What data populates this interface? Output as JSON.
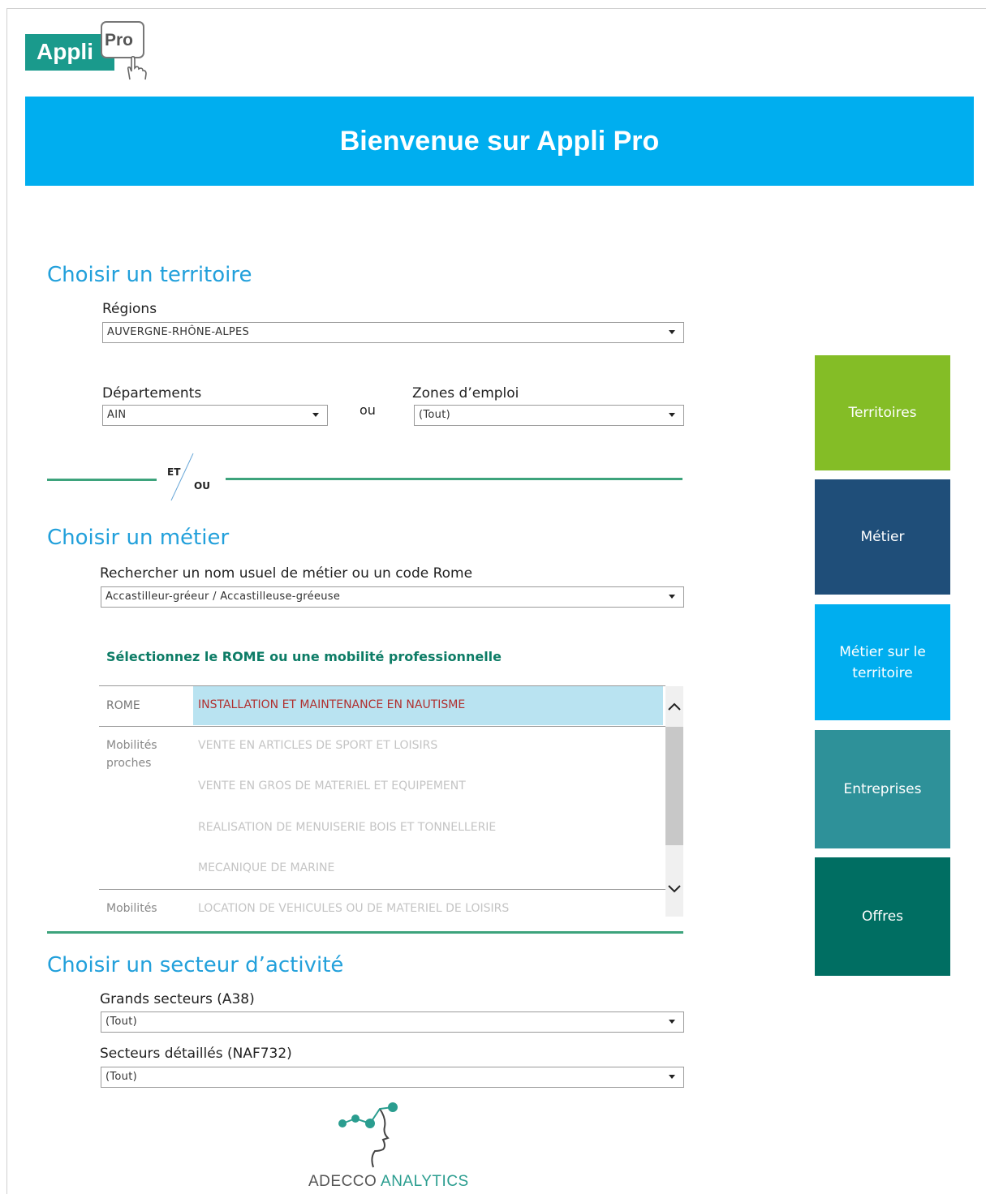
{
  "logo": {
    "word": "Appli",
    "badge": "Pro"
  },
  "banner": {
    "title": "Bienvenue sur Appli Pro",
    "color": "#00aeef"
  },
  "territoire": {
    "title": "Choisir un territoire",
    "regions_label": "Régions",
    "regions_value": "AUVERGNE-RHÔNE-ALPES",
    "departements_label": "Départements",
    "departements_value": "AIN",
    "ou": "ou",
    "zones_label": "Zones d’emploi",
    "zones_value": "(Tout)"
  },
  "separator": {
    "et": "ET",
    "ou": "OU"
  },
  "metier": {
    "title": "Choisir un métier",
    "search_label": "Rechercher un nom usuel de métier ou un code Rome",
    "search_value": "Accastilleur-gréeur / Accastilleuse-gréeuse",
    "subhead": "Sélectionnez le ROME ou une mobilité professionnelle",
    "rome_label": "ROME",
    "rome_value": "INSTALLATION ET MAINTENANCE EN NAUTISME",
    "mobilites_proches_label": "Mobilités proches",
    "mobilites_proches": [
      "VENTE EN ARTICLES DE SPORT ET LOISIRS",
      "VENTE EN GROS DE MATERIEL ET EQUIPEMENT",
      "REALISATION DE MENUISERIE BOIS ET TONNELLERIE",
      "MECANIQUE DE MARINE"
    ],
    "mobilites_label": "Mobilités",
    "mobilites_item": "LOCATION DE VEHICULES OU DE MATERIEL DE LOISIRS"
  },
  "secteur": {
    "title": "Choisir un secteur d’activité",
    "grands_label": "Grands secteurs (A38)",
    "grands_value": "(Tout)",
    "detailles_label": "Secteurs détaillés (NAF732)",
    "detailles_value": "(Tout)"
  },
  "nav": [
    {
      "label": "Territoires",
      "color": "#84bd26"
    },
    {
      "label": "Métier",
      "color": "#1f4e79"
    },
    {
      "label": "Métier sur le territoire",
      "color": "#00aeef"
    },
    {
      "label": "Entreprises",
      "color": "#2e9199"
    },
    {
      "label": "Offres",
      "color": "#006e62"
    }
  ],
  "footer": {
    "brand_1": "ADECCO",
    "brand_2": "ANALYTICS"
  }
}
